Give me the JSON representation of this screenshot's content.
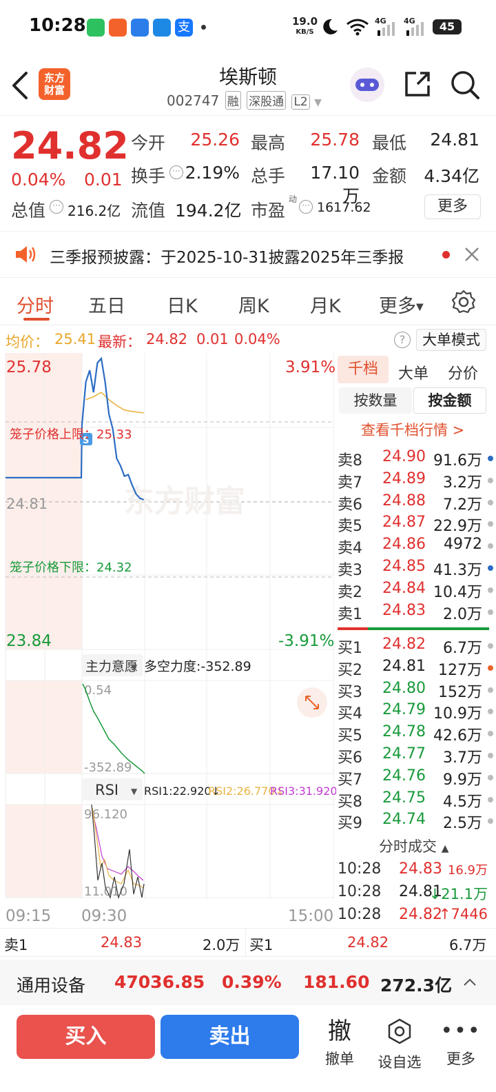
{
  "status": {
    "time": "10:28",
    "net_speed_value": "19.0",
    "net_speed_unit": "KB/S",
    "battery": "45",
    "sim1": "4G",
    "sim2": "4G"
  },
  "header": {
    "logo_line1": "东方",
    "logo_line2": "财富",
    "stock_name": "埃斯顿",
    "stock_code": "002747",
    "tag_rong": "融",
    "tag_market": "深股通",
    "tag_level": "L2"
  },
  "quote": {
    "price": "24.82",
    "change_pct": "0.04%",
    "change": "0.01",
    "open_label": "今开",
    "open": "25.26",
    "high_label": "最高",
    "high": "25.78",
    "low_label": "最低",
    "low": "24.81",
    "turnover_label": "换手",
    "turnover": "2.19%",
    "volume_label": "总手",
    "volume": "17.10万",
    "amount_label": "金额",
    "amount": "4.34亿",
    "mktcap_label": "总值",
    "mktcap": "216.2亿",
    "float_label": "流值",
    "float": "194.2亿",
    "pe_label": "市盈",
    "pe_sup": "动",
    "pe": "1617.62",
    "more": "更多"
  },
  "notice": {
    "text": "三季报预披露：于2025-10-31披露2025年三季报"
  },
  "tabs": [
    "分时",
    "五日",
    "日K",
    "周K",
    "月K",
    "更多"
  ],
  "infoline": {
    "avg_label": "均价：",
    "avg": "25.41",
    "latest_label": "最新：",
    "latest": "24.82",
    "chg": "0.01",
    "chg_pct": "0.04%",
    "mode": "大单模式"
  },
  "chart": {
    "price_top": "25.78",
    "price_bottom": "23.84",
    "price_mid": "24.81",
    "pct_top": "3.91%",
    "pct_bottom": "-3.91%",
    "upper_limit": "笼子价格上限：25.33",
    "lower_limit": "笼子价格下限：24.32",
    "ind1_name": "主力意愿",
    "ind1_value": "多空力度:-352.89",
    "ind1_top": "0.54",
    "ind1_bottom": "-352.89",
    "rsi_name": "RSI",
    "rsi1": "RSI1:22.920↓",
    "rsi2": "RSI2:26.770↓",
    "rsi3": "RSI3:31.920↓",
    "rsi_top": "96.120",
    "rsi_bottom": "11.010",
    "t_start": "09:15",
    "t_open": "09:30",
    "t_end": "15:00",
    "watermark": "东方财富",
    "marker": "S"
  },
  "chart_data": {
    "type": "line",
    "series": [
      {
        "name": "price",
        "color": "#2b6cc4",
        "points": [
          [
            0,
            24.97
          ],
          [
            1,
            24.97
          ],
          [
            2,
            24.97
          ],
          [
            3,
            25.33
          ],
          [
            4,
            25.62
          ],
          [
            5,
            25.7
          ],
          [
            6,
            25.55
          ],
          [
            7,
            25.75
          ],
          [
            8,
            25.78
          ],
          [
            9,
            25.62
          ],
          [
            10,
            25.4
          ],
          [
            11,
            25.3
          ],
          [
            12,
            25.1
          ],
          [
            13,
            25.05
          ],
          [
            14,
            24.98
          ],
          [
            15,
            24.99
          ],
          [
            16,
            24.92
          ],
          [
            17,
            24.86
          ],
          [
            18,
            24.83
          ],
          [
            19,
            24.82
          ]
        ]
      },
      {
        "name": "avg",
        "color": "#e9b341",
        "points": [
          [
            4,
            25.5
          ],
          [
            6,
            25.52
          ],
          [
            8,
            25.55
          ],
          [
            10,
            25.5
          ],
          [
            12,
            25.46
          ],
          [
            14,
            25.43
          ],
          [
            16,
            25.42
          ],
          [
            19,
            25.41
          ]
        ]
      }
    ],
    "ylim": [
      23.84,
      25.78
    ]
  },
  "book": {
    "tabs": [
      "千档",
      "大单",
      "分价"
    ],
    "subtabs": [
      "按数量",
      "按金额"
    ],
    "link": "查看千档行情 >",
    "asks": [
      {
        "label": "卖8",
        "price": "24.90",
        "vol": "91.6万",
        "dot": "#2b6cc4"
      },
      {
        "label": "卖7",
        "price": "24.89",
        "vol": "3.2万",
        "dot": "#bbb"
      },
      {
        "label": "卖6",
        "price": "24.88",
        "vol": "7.2万",
        "dot": "#bbb"
      },
      {
        "label": "卖5",
        "price": "24.87",
        "vol": "22.9万",
        "dot": "#bbb"
      },
      {
        "label": "卖4",
        "price": "24.86",
        "vol": "4972",
        "dot": "#bbb"
      },
      {
        "label": "卖3",
        "price": "24.85",
        "vol": "41.3万",
        "dot": "#2b6cc4"
      },
      {
        "label": "卖2",
        "price": "24.84",
        "vol": "10.4万",
        "dot": "#bbb"
      },
      {
        "label": "卖1",
        "price": "24.83",
        "vol": "2.0万",
        "dot": "#bbb"
      }
    ],
    "bids": [
      {
        "label": "买1",
        "price": "24.82",
        "vol": "6.7万",
        "dot": "#bbb",
        "cls": "red"
      },
      {
        "label": "买2",
        "price": "24.81",
        "vol": "127万",
        "dot": "#e9632b",
        "cls": "dark"
      },
      {
        "label": "买3",
        "price": "24.80",
        "vol": "152万",
        "dot": "#bbb",
        "cls": "green"
      },
      {
        "label": "买4",
        "price": "24.79",
        "vol": "10.9万",
        "dot": "#bbb",
        "cls": "green"
      },
      {
        "label": "买5",
        "price": "24.78",
        "vol": "42.6万",
        "dot": "#bbb",
        "cls": "green"
      },
      {
        "label": "买6",
        "price": "24.77",
        "vol": "3.7万",
        "dot": "#bbb",
        "cls": "green"
      },
      {
        "label": "买7",
        "price": "24.76",
        "vol": "9.9万",
        "dot": "#bbb",
        "cls": "green"
      },
      {
        "label": "买8",
        "price": "24.75",
        "vol": "4.5万",
        "dot": "#bbb",
        "cls": "green"
      },
      {
        "label": "买9",
        "price": "24.74",
        "vol": "2.5万",
        "dot": "#bbb",
        "cls": "green"
      }
    ],
    "trades_title": "分时成交",
    "trades": [
      {
        "time": "10:28",
        "price": "24.83",
        "vol": "16.9万",
        "pcls": "red",
        "vcls": "red"
      },
      {
        "time": "10:28",
        "price": "24.81",
        "vol": "↓21.1万",
        "pcls": "dark",
        "vcls": "green"
      },
      {
        "time": "10:28",
        "price": "24.82",
        "vol": "↑7446",
        "pcls": "red",
        "vcls": "red"
      }
    ]
  },
  "bidbar": {
    "ask_label": "卖1",
    "ask_price": "24.83",
    "ask_vol": "2.0万",
    "bid_label": "买1",
    "bid_price": "24.82",
    "bid_vol": "6.7万"
  },
  "sector": {
    "name": "通用设备",
    "index": "47036.85",
    "pct": "0.39%",
    "chg": "181.60",
    "amount": "272.3亿"
  },
  "actions": {
    "buy": "买入",
    "sell": "卖出",
    "cancel_glyph": "撤",
    "cancel": "撤单",
    "watch": "设自选",
    "more": "更多"
  }
}
